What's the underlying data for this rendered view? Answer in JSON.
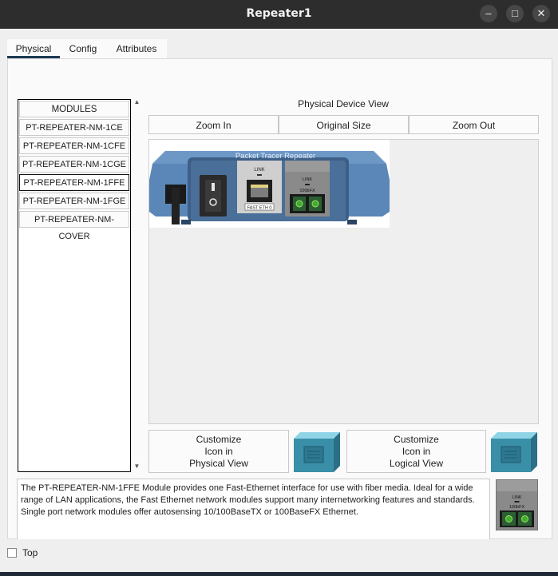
{
  "window": {
    "title": "Repeater1",
    "controls": {
      "minimize": "–",
      "maximize": "□",
      "close": "✕"
    }
  },
  "tabs": [
    {
      "label": "Physical",
      "active": true
    },
    {
      "label": "Config",
      "active": false
    },
    {
      "label": "Attributes",
      "active": false
    }
  ],
  "modules": {
    "header": "MODULES",
    "items": [
      {
        "label": "PT-REPEATER-NM-1CE",
        "selected": false
      },
      {
        "label": "PT-REPEATER-NM-1CFE",
        "selected": false
      },
      {
        "label": "PT-REPEATER-NM-1CGE",
        "selected": false
      },
      {
        "label": "PT-REPEATER-NM-1FFE",
        "selected": true
      },
      {
        "label": "PT-REPEATER-NM-1FGE",
        "selected": false
      },
      {
        "label": "PT-REPEATER-NM-COVER",
        "selected": false
      }
    ]
  },
  "physical_view": {
    "label": "Physical Device View",
    "zoom_in": "Zoom In",
    "original_size": "Original Size",
    "zoom_out": "Zoom Out",
    "device": {
      "name_text": "Packet Tracer Repeater",
      "port1_link": "LINK",
      "port1_label": "FAST ETH 0",
      "port2_link": "LINK",
      "port2_label": "100bFX"
    }
  },
  "customize": {
    "physical": [
      "Customize",
      "Icon in",
      "Physical View"
    ],
    "logical": [
      "Customize",
      "Icon in",
      "Logical View"
    ]
  },
  "description": "The PT-REPEATER-NM-1FFE Module provides one Fast-Ethernet interface for use with fiber media. Ideal for a wide range of LAN applications, the Fast Ethernet network modules support many internetworking features and standards. Single port network modules offer autosensing 10/100BaseTX or 100BaseFX Ethernet.",
  "module_thumb": {
    "link": "LINK",
    "label": "100bFX"
  },
  "footer": {
    "top_checkbox_label": "Top",
    "top_checked": false
  },
  "colors": {
    "titlebar": "#2d2d2d",
    "device_blue": "#5a87b8",
    "icon_teal": "#3a8fa8",
    "tab_underline": "#1f3a52",
    "port_green": "#3fae2a"
  }
}
